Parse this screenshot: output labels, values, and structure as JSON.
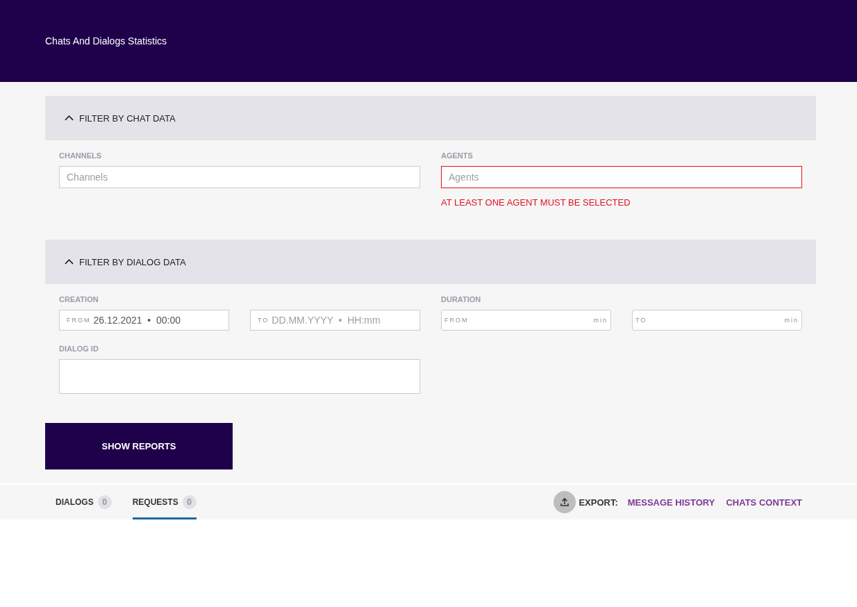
{
  "header": {
    "title": "Chats And Dialogs Statistics"
  },
  "chat_section": {
    "title": "FILTER BY CHAT DATA",
    "expanded": true,
    "channels": {
      "label": "CHANNELS",
      "placeholder": "Channels",
      "error": false
    },
    "agents": {
      "label": "AGENTS",
      "placeholder": "Agents",
      "error": true,
      "error_text": "AT LEAST ONE AGENT MUST BE SELECTED"
    }
  },
  "dialog_section": {
    "title": "FILTER BY DIALOG DATA",
    "expanded": true,
    "creation": {
      "label": "CREATION",
      "from": {
        "prefix": "FROM",
        "value": "26.12.2021  •  00:00"
      },
      "to": {
        "prefix": "TO",
        "placeholder": "DD.MM.YYYY  •  HH:mm"
      }
    },
    "duration": {
      "label": "DURATION",
      "from": {
        "prefix": "FROM",
        "unit": "min"
      },
      "to": {
        "prefix": "TO",
        "unit": "min"
      }
    },
    "dialog_id": {
      "label": "DIALOG ID"
    }
  },
  "show_button": "SHOW REPORTS",
  "tabs": [
    {
      "label": "DIALOGS",
      "count": "0",
      "selected": false
    },
    {
      "label": "REQUESTS",
      "count": "0",
      "selected": true
    }
  ],
  "export": {
    "label": "EXPORT:",
    "links": [
      "MESSAGE HISTORY",
      "CHATS CONTEXT"
    ]
  }
}
